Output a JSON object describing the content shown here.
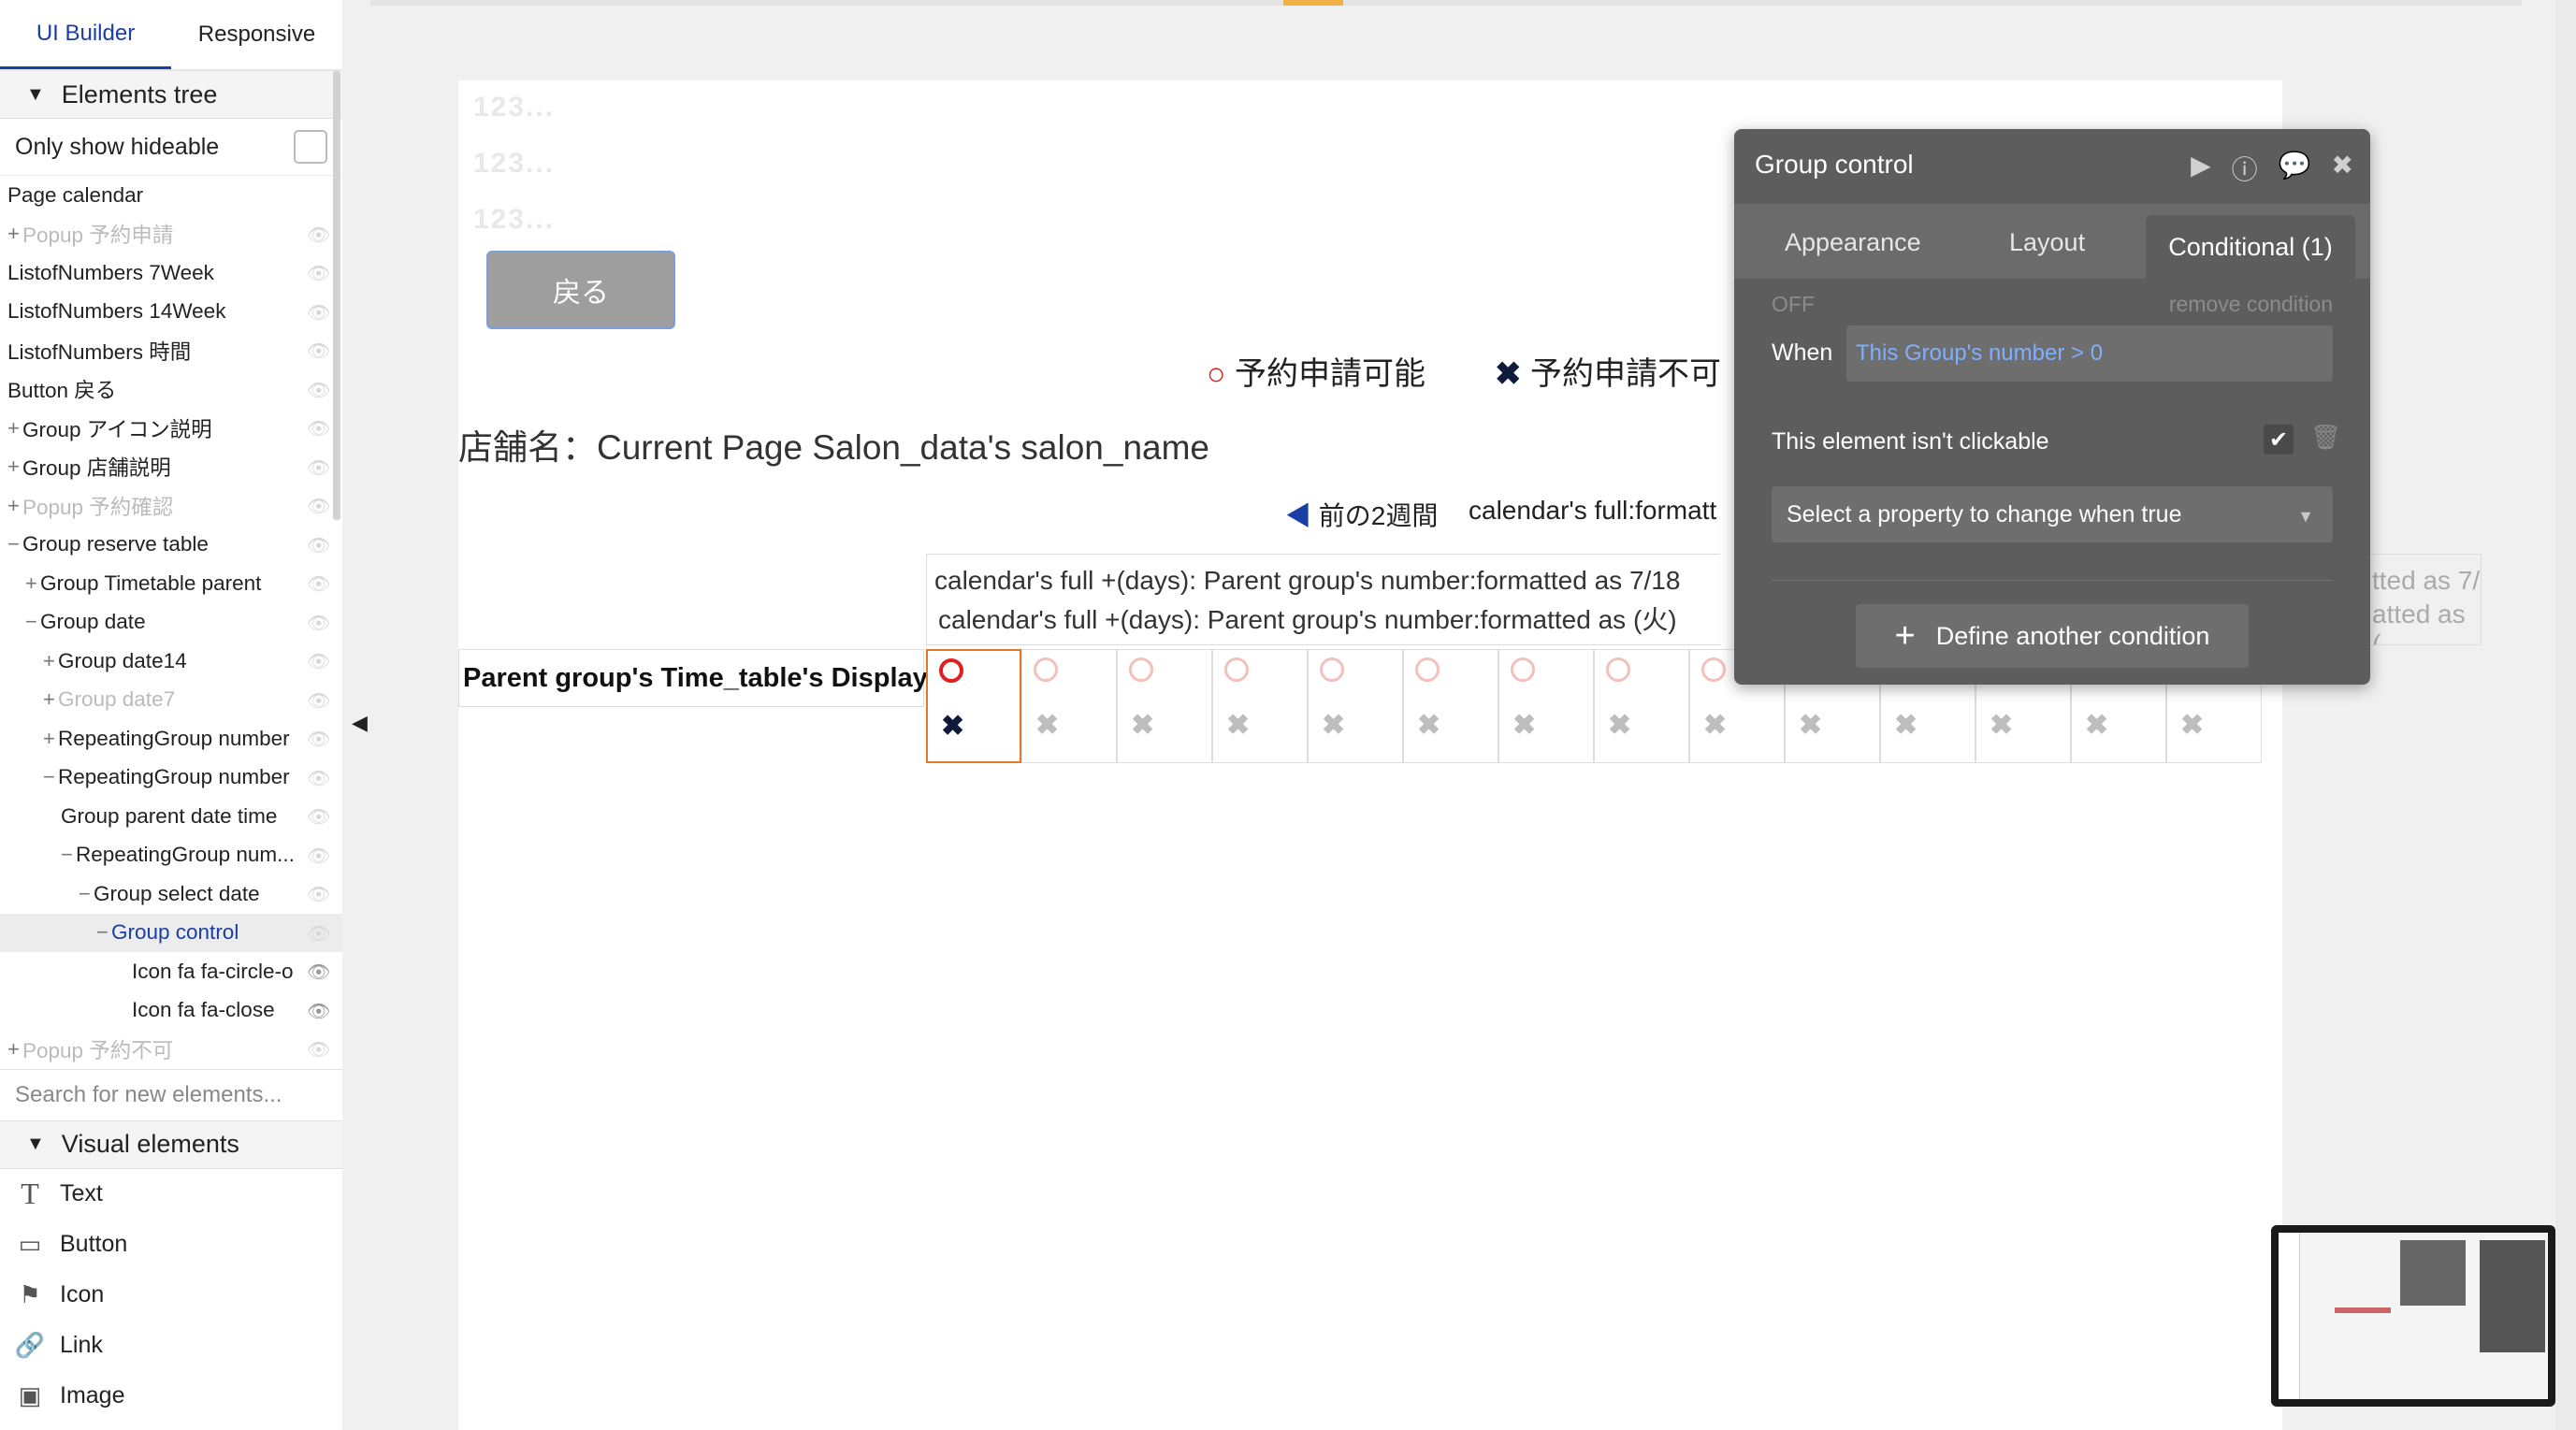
{
  "sidebar": {
    "tabs": [
      "UI Builder",
      "Responsive"
    ],
    "elements_tree_title": "Elements tree",
    "only_show_hideable": "Only show hideable",
    "tree": [
      {
        "label": "Page calendar",
        "indent": 0,
        "prefix": "",
        "faded": false,
        "selected": false,
        "eye": false
      },
      {
        "label": "Popup 予約申請",
        "indent": 0,
        "prefix": "+",
        "faded": true,
        "selected": false,
        "eye": true
      },
      {
        "label": "ListofNumbers 7Week",
        "indent": 0,
        "prefix": "",
        "faded": false,
        "selected": false,
        "eye": true
      },
      {
        "label": "ListofNumbers 14Week",
        "indent": 0,
        "prefix": "",
        "faded": false,
        "selected": false,
        "eye": true
      },
      {
        "label": "ListofNumbers 時間",
        "indent": 0,
        "prefix": "",
        "faded": false,
        "selected": false,
        "eye": true
      },
      {
        "label": "Button 戻る",
        "indent": 0,
        "prefix": "",
        "faded": false,
        "selected": false,
        "eye": true
      },
      {
        "label": "Group アイコン説明",
        "indent": 0,
        "prefix": "+",
        "faded": false,
        "selected": false,
        "eye": true
      },
      {
        "label": "Group 店舗説明",
        "indent": 0,
        "prefix": "+",
        "faded": false,
        "selected": false,
        "eye": true
      },
      {
        "label": "Popup 予約確認",
        "indent": 0,
        "prefix": "+",
        "faded": true,
        "selected": false,
        "eye": true
      },
      {
        "label": "Group reserve table",
        "indent": 0,
        "prefix": "−",
        "faded": false,
        "selected": false,
        "eye": true
      },
      {
        "label": "Group Timetable parent",
        "indent": 1,
        "prefix": "+",
        "faded": false,
        "selected": false,
        "eye": true
      },
      {
        "label": "Group date",
        "indent": 1,
        "prefix": "−",
        "faded": false,
        "selected": false,
        "eye": true
      },
      {
        "label": "Group date14",
        "indent": 2,
        "prefix": "+",
        "faded": false,
        "selected": false,
        "eye": true
      },
      {
        "label": "Group date7",
        "indent": 2,
        "prefix": "+",
        "faded": true,
        "selected": false,
        "eye": true
      },
      {
        "label": "RepeatingGroup number",
        "indent": 2,
        "prefix": "+",
        "faded": false,
        "selected": false,
        "eye": true
      },
      {
        "label": "RepeatingGroup number",
        "indent": 2,
        "prefix": "−",
        "faded": false,
        "selected": false,
        "eye": true
      },
      {
        "label": "Group parent date time",
        "indent": 3,
        "prefix": "",
        "faded": false,
        "selected": false,
        "eye": true
      },
      {
        "label": "RepeatingGroup num...",
        "indent": 3,
        "prefix": "−",
        "faded": false,
        "selected": false,
        "eye": true
      },
      {
        "label": "Group select date",
        "indent": 4,
        "prefix": "−",
        "faded": false,
        "selected": false,
        "eye": true
      },
      {
        "label": "Group control",
        "indent": 5,
        "prefix": "−",
        "faded": false,
        "selected": true,
        "eye": true
      },
      {
        "label": "Icon fa fa-circle-o",
        "indent": 7,
        "prefix": "",
        "faded": false,
        "selected": false,
        "eye": true
      },
      {
        "label": "Icon fa fa-close",
        "indent": 7,
        "prefix": "",
        "faded": false,
        "selected": false,
        "eye": true
      },
      {
        "label": "Popup 予約不可",
        "indent": 0,
        "prefix": "+",
        "faded": true,
        "selected": false,
        "eye": true
      }
    ],
    "search_placeholder": "Search for new elements...",
    "visual_elements_title": "Visual elements",
    "visual_elements": [
      {
        "label": "Text",
        "icon": "text-icon"
      },
      {
        "label": "Button",
        "icon": "button-icon"
      },
      {
        "label": "Icon",
        "icon": "flag-icon"
      },
      {
        "label": "Link",
        "icon": "link-icon"
      },
      {
        "label": "Image",
        "icon": "image-icon"
      }
    ]
  },
  "canvas": {
    "ghost_texts": [
      "123...",
      "123...",
      "123..."
    ],
    "back_button": "戻る",
    "legend_available": "予約申請可能",
    "legend_unavailable": "予約申請不可",
    "salon_name": "店舗名：Current Page Salon_data's salon_name",
    "prev_weeks": "前の2週間",
    "calendar_nav_text": "calendar's full:formatt",
    "cal_header_line1": "calendar's full +(days): Parent group's number:formatted as 7/18",
    "cal_header_line2": "calendar's full +(days): Parent group's number:formatted as (火)",
    "cal_header_right1": "tted as 7/",
    "cal_header_right2": "atted as (",
    "row_label": "Parent group's Time_table's Display",
    "cell_count": 14
  },
  "panel": {
    "title": "Group control",
    "tabs": [
      "Appearance",
      "Layout",
      "Conditional (1)"
    ],
    "off_label": "OFF",
    "remove_condition": "remove condition",
    "when_label": "When",
    "when_value": "This Group's number > 0",
    "not_clickable_label": "This element isn't clickable",
    "select_placeholder": "Select a property to change when true",
    "define_button": "Define another condition"
  },
  "colors": {
    "accent_blue": "#1a3ea8",
    "circle_red": "#e02020",
    "panel_bg": "#5d5d5d",
    "when_text": "#7fb0ff",
    "selection_orange": "#e07a28"
  }
}
